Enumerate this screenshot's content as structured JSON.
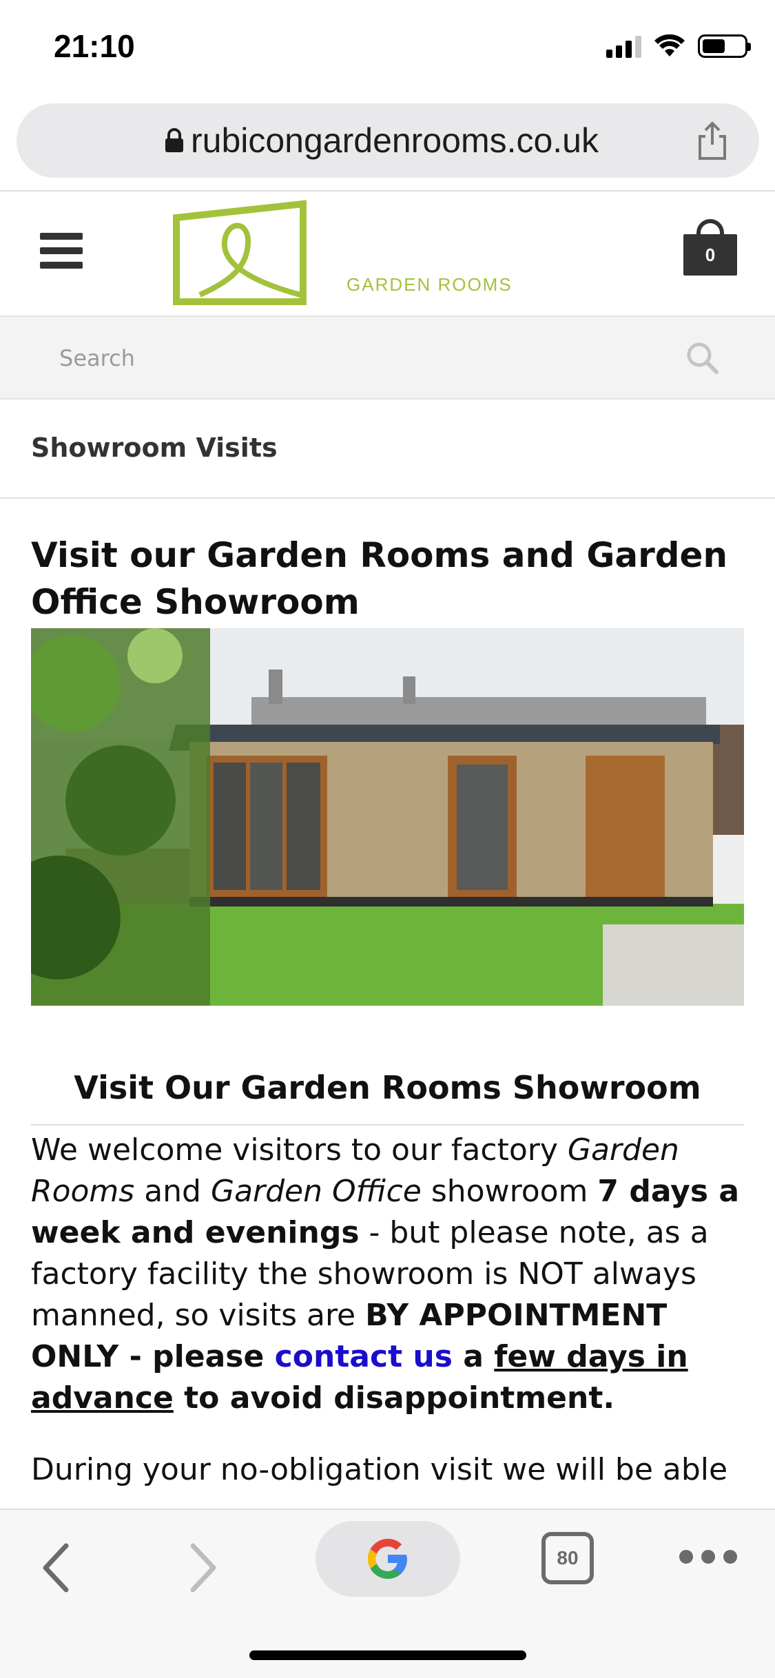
{
  "status_bar": {
    "time": "21:10"
  },
  "browser": {
    "url": "rubicongardenrooms.co.uk"
  },
  "header": {
    "logo_text": "GARDEN ROOMS",
    "cart_count": "0",
    "brand_color": "#a3c23c"
  },
  "search": {
    "placeholder": "Search"
  },
  "page": {
    "heading": "Showroom Visits",
    "title": "Visit our Garden Rooms and Garden Office Showroom",
    "subtitle": "Visit Our Garden Rooms Showroom"
  },
  "body_text": {
    "p1_a": "We welcome visitors to our factory ",
    "p1_b": "Garden Rooms",
    "p1_c": " and ",
    "p1_d": "Garden Office",
    "p1_e": " showroom ",
    "p1_f": "7 days a week and evenings",
    "p1_g": " - but please note, as a factory facility the showroom is NOT always manned, so visits are ",
    "p1_h": "BY APPOINTMENT ONLY - please ",
    "p1_link": "contact us",
    "p1_i": " a ",
    "p1_j": "few days in advance",
    "p1_k": " to avoid disappointment.",
    "p2": "During your no-obligation visit we will be able"
  },
  "toolbar": {
    "tabs_count": "80"
  },
  "icons": [
    "lock-icon",
    "share-icon",
    "menu-icon",
    "cart-icon",
    "search-icon",
    "back-icon",
    "forward-icon",
    "google-icon",
    "tabs-icon",
    "more-icon"
  ]
}
